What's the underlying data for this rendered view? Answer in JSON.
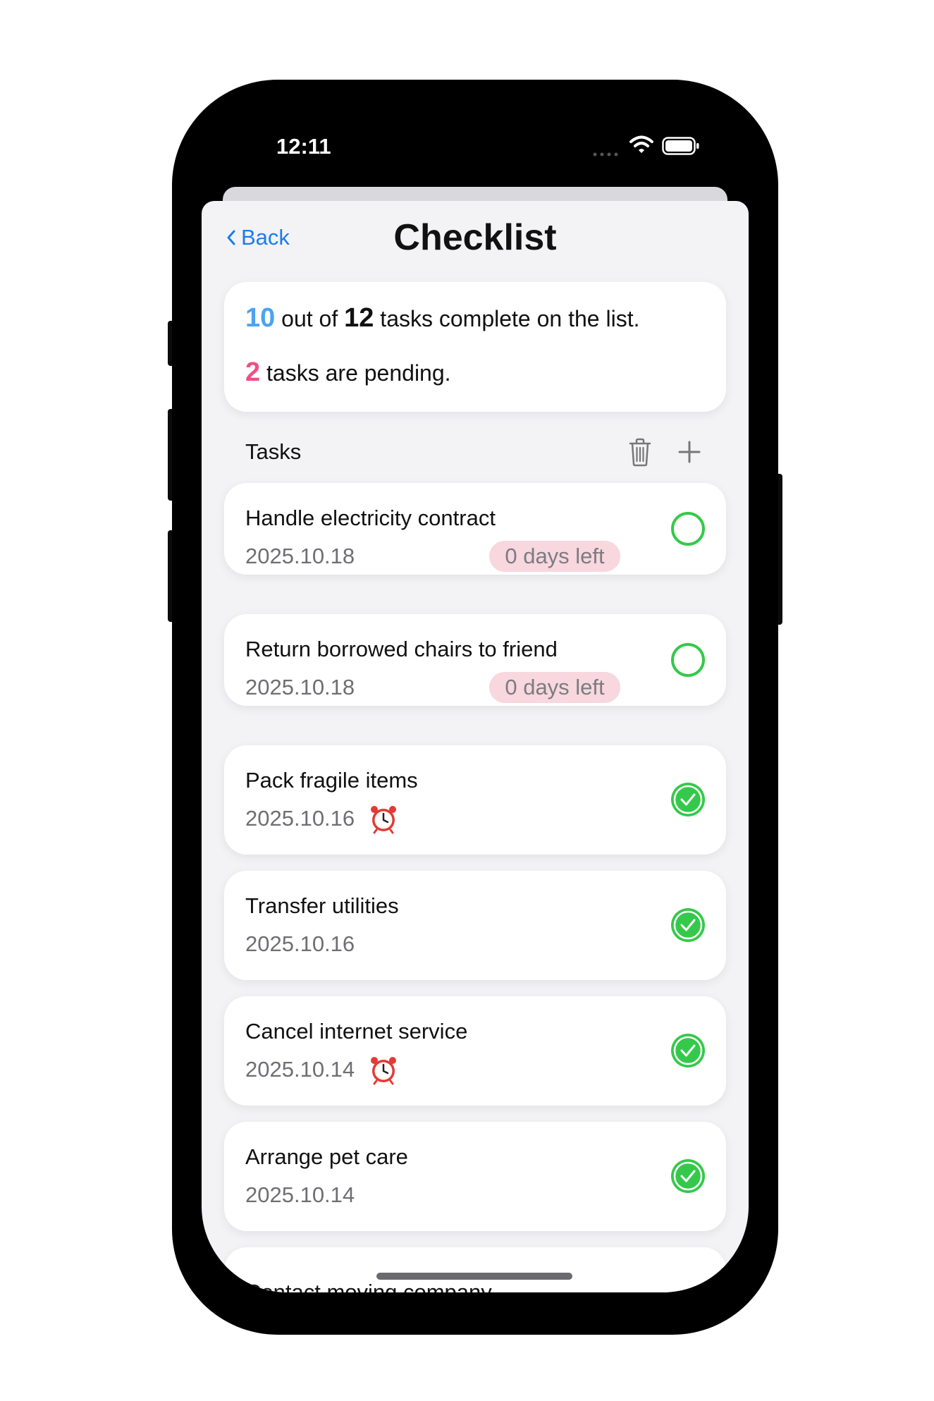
{
  "status_bar": {
    "time": "12:11"
  },
  "nav": {
    "back_label": "Back",
    "title": "Checklist"
  },
  "summary": {
    "completed": "10",
    "between": " out of ",
    "total": "12",
    "suffix": " tasks complete on the list.",
    "pending": "2",
    "pending_suffix": " tasks are pending."
  },
  "tasks_section": {
    "header": "Tasks"
  },
  "tasks": [
    {
      "title": "Handle electricity contract",
      "date": "2025.10.18",
      "badge": "0 days left",
      "alarm": false,
      "completed": false
    },
    {
      "title": "Return borrowed chairs to friend",
      "date": "2025.10.18",
      "badge": "0 days left",
      "alarm": false,
      "completed": false
    },
    {
      "title": "Pack fragile items",
      "date": "2025.10.16",
      "badge": "",
      "alarm": true,
      "completed": true
    },
    {
      "title": "Transfer utilities",
      "date": "2025.10.16",
      "badge": "",
      "alarm": false,
      "completed": true
    },
    {
      "title": "Cancel internet service",
      "date": "2025.10.14",
      "badge": "",
      "alarm": true,
      "completed": true
    },
    {
      "title": "Arrange pet care",
      "date": "2025.10.14",
      "badge": "",
      "alarm": false,
      "completed": true
    },
    {
      "title": "Contact moving company",
      "date": "",
      "badge": "",
      "alarm": false,
      "completed": true
    }
  ],
  "colors": {
    "accent_blue": "#1a7cf0",
    "completed_count": "#4da3ee",
    "pending_count": "#ee4f86",
    "check_green": "#34c94a",
    "badge_bg": "#f8d7df"
  },
  "icons": {
    "back": "chevron-left-icon",
    "trash": "trash-icon",
    "add": "plus-icon",
    "alarm": "alarm-clock-icon",
    "done": "checkmark-circle-icon",
    "todo": "empty-circle-icon"
  }
}
